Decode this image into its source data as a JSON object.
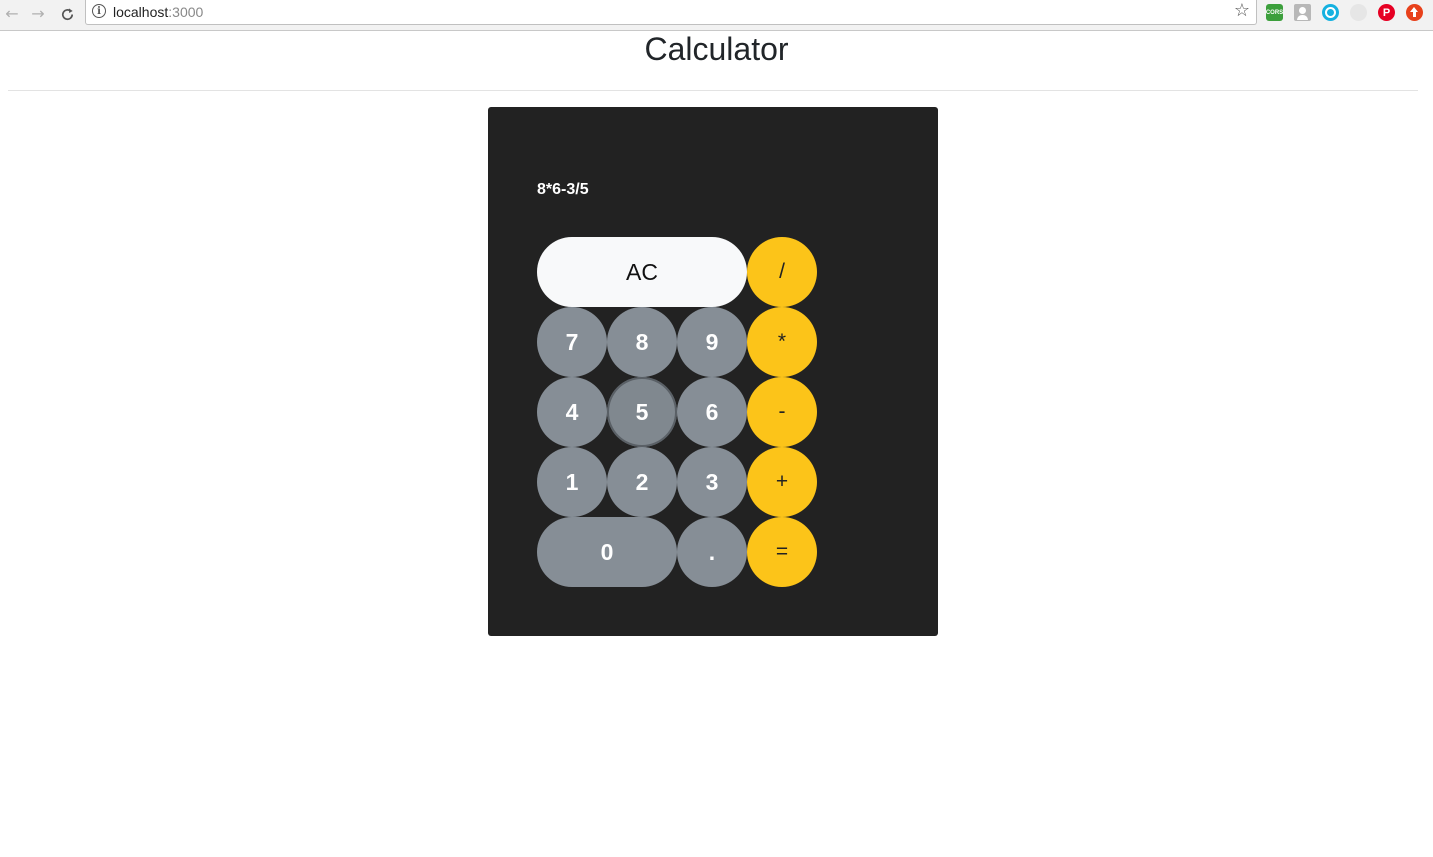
{
  "browser": {
    "url_host": "localhost",
    "url_port": ":3000",
    "icons": {
      "back": "arrow-left-icon",
      "forward": "arrow-right-icon",
      "reload": "reload-icon",
      "info": "info-icon",
      "bookmark": "star-icon"
    },
    "extensions": [
      {
        "name": "cors-extension",
        "label": "CORS"
      },
      {
        "name": "user-extension",
        "label": ""
      },
      {
        "name": "grammarly-extension",
        "label": ""
      },
      {
        "name": "faded-extension",
        "label": ""
      },
      {
        "name": "pinterest-extension",
        "label": "P"
      },
      {
        "name": "upload-extension",
        "label": ""
      }
    ]
  },
  "page": {
    "title": "Calculator"
  },
  "calculator": {
    "display": "8*6-3/5",
    "keys": {
      "clear": "AC",
      "divide": "/",
      "seven": "7",
      "eight": "8",
      "nine": "9",
      "multiply": "*",
      "four": "4",
      "five": "5",
      "six": "6",
      "subtract": "-",
      "one": "1",
      "two": "2",
      "three": "3",
      "add": "+",
      "zero": "0",
      "decimal": ".",
      "equals": "="
    },
    "colors": {
      "body": "#222222",
      "number_key": "#868e96",
      "operator_key": "#fcc419",
      "clear_key": "#f8f9fa"
    }
  }
}
